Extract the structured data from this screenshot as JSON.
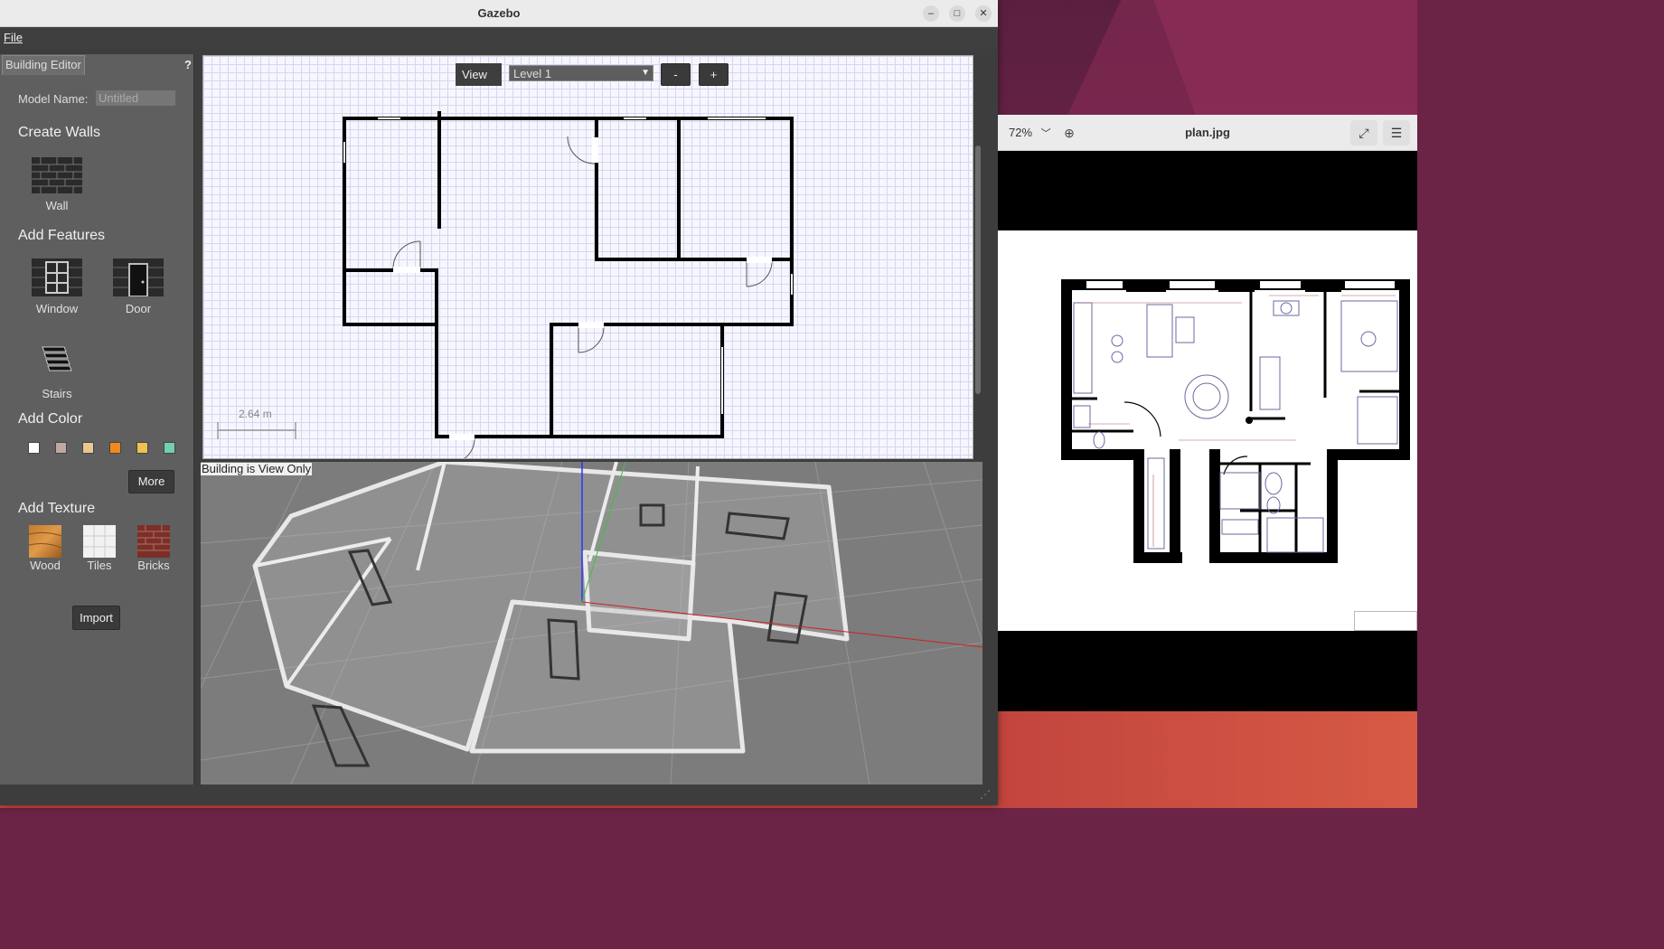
{
  "gazebo": {
    "title": "Gazebo",
    "menu": {
      "file": "File"
    },
    "panel": {
      "tab": "Building Editor",
      "help": "?",
      "model_name_label": "Model Name:",
      "model_name_value": "Untitled",
      "create_walls": "Create Walls",
      "wall": "Wall",
      "add_features": "Add Features",
      "window": "Window",
      "door": "Door",
      "stairs": "Stairs",
      "add_color": "Add Color",
      "colors": [
        "#ffffff",
        "#c0a8a0",
        "#e8c890",
        "#f08a1c",
        "#f0c050",
        "#70d0b0"
      ],
      "more": "More",
      "add_texture": "Add Texture",
      "textures": [
        "Wood",
        "Tiles",
        "Bricks"
      ],
      "import": "Import"
    },
    "view2d": {
      "view_button": "View",
      "level": "Level 1",
      "zoom_out": "-",
      "zoom_in": "+",
      "scale": "2.64 m"
    },
    "view3d": {
      "status": "Building is View Only"
    }
  },
  "viewer": {
    "zoom": "72%",
    "title": "plan.jpg"
  }
}
